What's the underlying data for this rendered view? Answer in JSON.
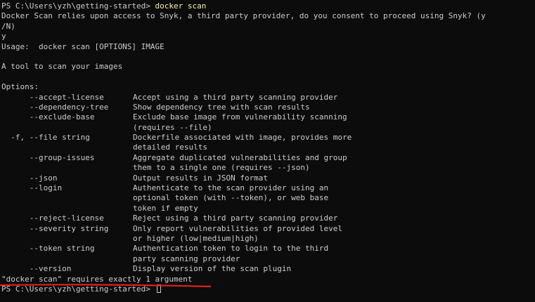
{
  "prompt": "PS C:\\Users\\yzh\\getting-started>",
  "command": "docker scan",
  "consent_question_1": "Docker Scan relies upon access to Snyk, a third party provider, do you consent to proceed using Snyk? (y",
  "consent_question_2": "/N)",
  "answer": "y",
  "usage": "Usage:  docker scan [OPTIONS] IMAGE",
  "description": "A tool to scan your images",
  "options_header": "Options:",
  "options": [
    {
      "name": "      --accept-license",
      "desc": "Accept using a third party scanning provider"
    },
    {
      "name": "      --dependency-tree",
      "desc": "Show dependency tree with scan results"
    },
    {
      "name": "      --exclude-base",
      "desc": "Exclude base image from vulnerability scanning"
    },
    {
      "name": "",
      "desc": "(requires --file)"
    },
    {
      "name": "  -f, --file string",
      "desc": "Dockerfile associated with image, provides more"
    },
    {
      "name": "",
      "desc": "detailed results"
    },
    {
      "name": "      --group-issues",
      "desc": "Aggregate duplicated vulnerabilities and group"
    },
    {
      "name": "",
      "desc": "them to a single one (requires --json)"
    },
    {
      "name": "      --json",
      "desc": "Output results in JSON format"
    },
    {
      "name": "      --login",
      "desc": "Authenticate to the scan provider using an"
    },
    {
      "name": "",
      "desc": "optional token (with --token), or web base"
    },
    {
      "name": "",
      "desc": "token if empty"
    },
    {
      "name": "      --reject-license",
      "desc": "Reject using a third party scanning provider"
    },
    {
      "name": "      --severity string",
      "desc": "Only report vulnerabilities of provided level"
    },
    {
      "name": "",
      "desc": "or higher (low|medium|high)"
    },
    {
      "name": "      --token string",
      "desc": "Authentication token to login to the third"
    },
    {
      "name": "",
      "desc": "party scanning provider"
    },
    {
      "name": "      --version",
      "desc": "Display version of the scan plugin"
    }
  ],
  "error": "\"docker scan\" requires exactly 1 argument",
  "final_prompt": "PS C:\\Users\\yzh\\getting-started>",
  "colors": {
    "background": "#0c0c0c",
    "text": "#cccccc",
    "command": "#f9f1a5",
    "annotation": "#e0201e"
  }
}
